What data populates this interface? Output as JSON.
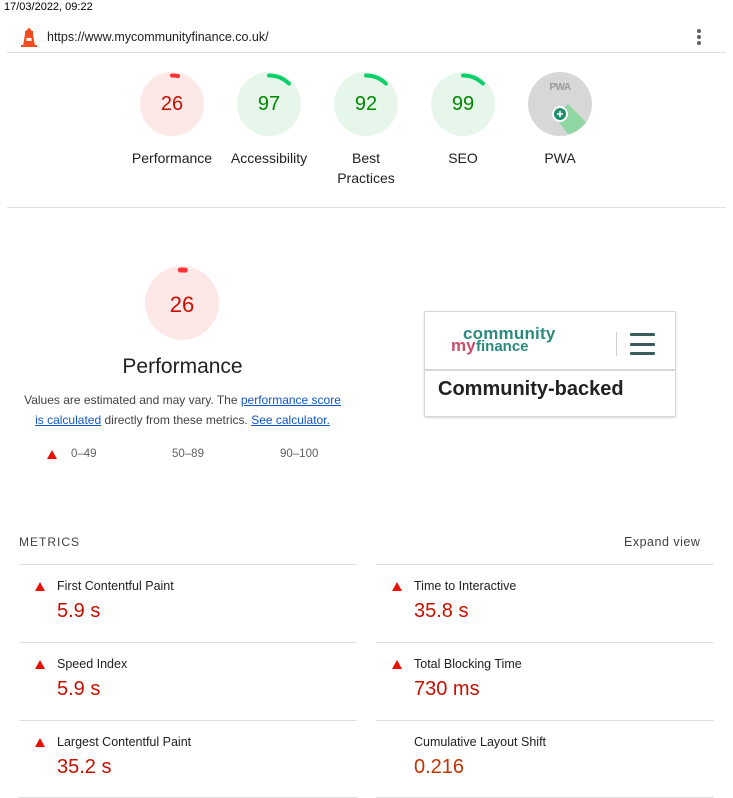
{
  "header": {
    "timestamp": "17/03/2022, 09:22",
    "url": "https://www.mycommunityfinance.co.uk/"
  },
  "gauges": [
    {
      "label": "Performance",
      "score": "26",
      "score_fraction": 0.26,
      "status": "fail"
    },
    {
      "label": "Accessibility",
      "score": "97",
      "score_fraction": 0.97,
      "status": "pass"
    },
    {
      "label": "Best Practices",
      "score": "92",
      "score_fraction": 0.92,
      "status": "pass"
    },
    {
      "label": "SEO",
      "score": "99",
      "score_fraction": 0.99,
      "status": "pass"
    },
    {
      "label": "PWA",
      "badge": "PWA",
      "status": "pwa"
    }
  ],
  "performance": {
    "score": "26",
    "score_fraction": 0.26,
    "title": "Performance",
    "desc_prefix": "Values are estimated and may vary. The ",
    "desc_link1": "performance score is calculated",
    "desc_middle": " directly from these metrics. ",
    "desc_link2": "See calculator.",
    "legend": {
      "fail": "0–49",
      "average": "50–89",
      "pass": "90–100"
    }
  },
  "screenshot": {
    "logo_community": "community",
    "logo_my": "my",
    "logo_finance": "finance",
    "headline": "Community-backed"
  },
  "metrics": {
    "title": "METRICS",
    "expand_label": "Expand view",
    "items": [
      {
        "label": "First Contentful Paint",
        "value": "5.9 s",
        "status": "fail"
      },
      {
        "label": "Time to Interactive",
        "value": "35.8 s",
        "status": "fail"
      },
      {
        "label": "Speed Index",
        "value": "5.9 s",
        "status": "fail"
      },
      {
        "label": "Total Blocking Time",
        "value": "730 ms",
        "status": "fail"
      },
      {
        "label": "Largest Contentful Paint",
        "value": "35.2 s",
        "status": "fail"
      },
      {
        "label": "Cumulative Layout Shift",
        "value": "0.216",
        "status": "fail"
      }
    ]
  },
  "colors": {
    "fail": "#c70f00",
    "fail_bg": "#fde8e8",
    "pass": "#008800",
    "pass_bg": "#e6f6ea",
    "pass_arc": "#0cce6b",
    "fail_arc": "#ff3333",
    "cls_value": "#c33300"
  }
}
